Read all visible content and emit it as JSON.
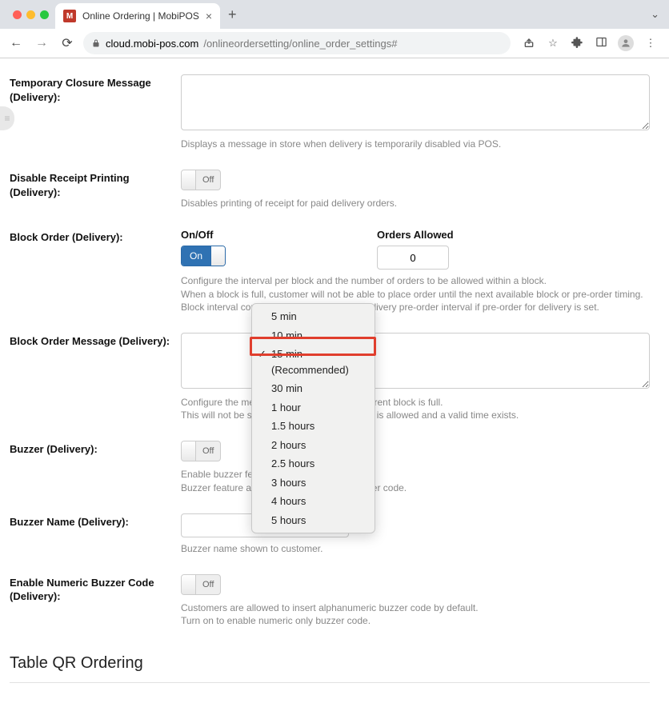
{
  "browser": {
    "tab_title": "Online Ordering | MobiPOS",
    "url_domain": "cloud.mobi-pos.com",
    "url_path": "/onlineordersetting/online_order_settings#"
  },
  "form": {
    "temp_closure": {
      "label": "Temporary Closure Message (Delivery):",
      "value": "",
      "help": "Displays a message in store when delivery is temporarily disabled via POS."
    },
    "disable_receipt": {
      "label": "Disable Receipt Printing (Delivery):",
      "state": "Off",
      "help": "Disables printing of receipt for paid delivery orders."
    },
    "block_order": {
      "label": "Block Order (Delivery):",
      "onoff_label": "On/Off",
      "onoff_state": "On",
      "orders_allowed_label": "Orders Allowed",
      "orders_allowed_value": "0",
      "help1": "Configure the interval per block and the number of orders to be allowed within a block.",
      "help2": "When a block is full, customer will not be able to place order until the next available block or pre-order timing.",
      "help3": "Block interval configured here will override delivery pre-order interval if pre-order for delivery is set."
    },
    "block_msg": {
      "label": "Block Order Message (Delivery):",
      "value": "",
      "help1": "Configure the message to be shown if the current block is full.",
      "help2": "This will not be shown if pre-order for delivery is allowed and a valid time exists."
    },
    "buzzer": {
      "label": "Buzzer (Delivery):",
      "state": "Off",
      "help1": "Enable buzzer feature for Delivery.",
      "help2": "Buzzer feature allows customer to input buzzer code."
    },
    "buzzer_name": {
      "label": "Buzzer Name (Delivery):",
      "value": "",
      "help": "Buzzer name shown to customer."
    },
    "numeric_buzzer": {
      "label": "Enable Numeric Buzzer Code (Delivery):",
      "state": "Off",
      "help1": "Customers are allowed to insert alphanumeric buzzer code by default.",
      "help2": "Turn on to enable numeric only buzzer code."
    }
  },
  "dropdown": {
    "options": [
      "5 min",
      "10 min",
      "15 min (Recommended)",
      "30 min",
      "1 hour",
      "1.5 hours",
      "2 hours",
      "2.5 hours",
      "3 hours",
      "4 hours",
      "5 hours"
    ],
    "selected_index": 2
  },
  "section": {
    "title": "Table QR Ordering"
  }
}
